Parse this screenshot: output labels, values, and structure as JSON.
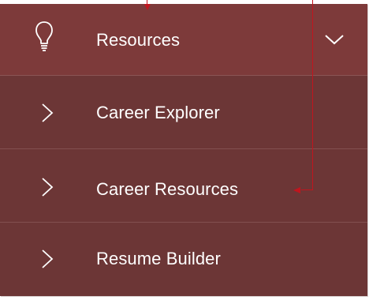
{
  "menu": {
    "header": {
      "label": "Resources",
      "icon": "lightbulb-icon",
      "toggle_icon": "chevron-down-icon"
    },
    "items": [
      {
        "label": "Career Explorer",
        "icon": "chevron-right-icon"
      },
      {
        "label": "Career Resources",
        "icon": "chevron-right-icon"
      },
      {
        "label": "Resume Builder",
        "icon": "chevron-right-icon"
      }
    ]
  },
  "colors": {
    "header_bg": "#7d3a3a",
    "menu_bg": "#6c3636",
    "text": "#ffffff",
    "annotation": "#c0151e"
  }
}
